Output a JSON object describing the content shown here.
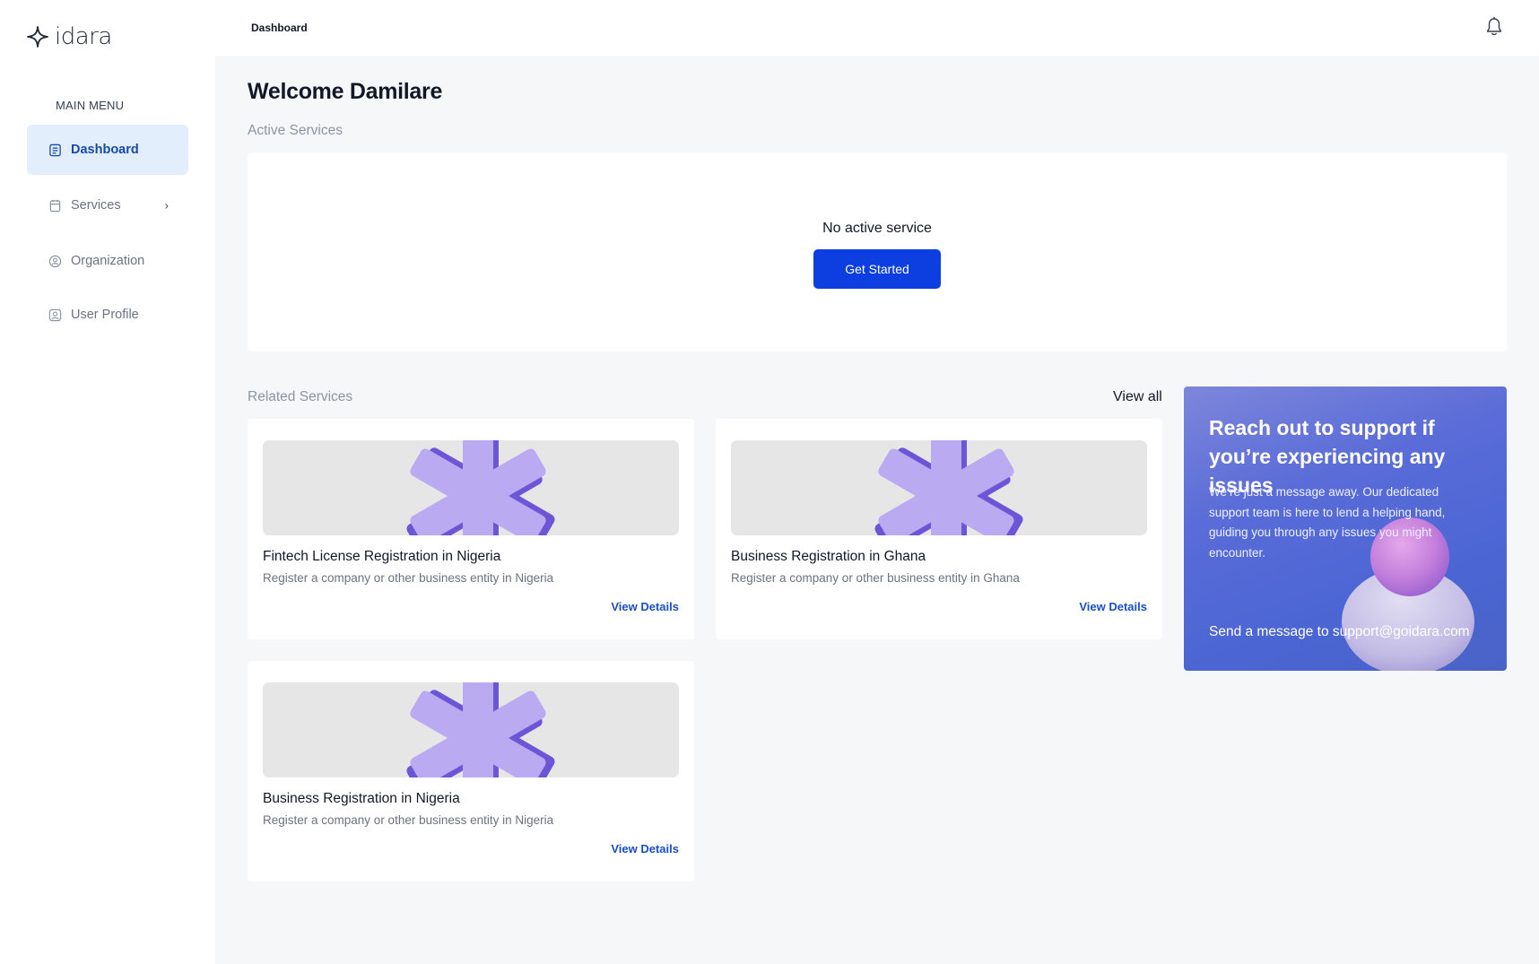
{
  "app": {
    "logo_text": "idara"
  },
  "sidebar": {
    "menu_title": "MAIN MENU",
    "items": [
      {
        "label": "Dashboard",
        "icon": "dashboard-icon",
        "active": true
      },
      {
        "label": "Services",
        "icon": "services-icon",
        "has_submenu": true
      },
      {
        "label": "Organization",
        "icon": "organization-icon"
      },
      {
        "label": "User Profile",
        "icon": "user-profile-icon"
      }
    ]
  },
  "header": {
    "breadcrumb": "Dashboard",
    "notification_icon": "bell-icon"
  },
  "main": {
    "welcome": "Welcome Damilare",
    "active_services": {
      "label": "Active Services",
      "empty_text": "No active service",
      "cta": "Get Started"
    },
    "related_services": {
      "label": "Related Services",
      "view_all": "View all",
      "cards": [
        {
          "title": "Fintech License Registration in Nigeria",
          "description": "Register a company or other business entity in Nigeria",
          "link": "View Details"
        },
        {
          "title": "Business Registration in Ghana",
          "description": "Register a company or other business entity in Ghana",
          "link": "View Details"
        },
        {
          "title": "Business Registration in Nigeria",
          "description": "Register a company or other business entity in Nigeria",
          "link": "View Details"
        }
      ]
    },
    "support": {
      "title": "Reach out to support if you’re experiencing any issues",
      "text": "We’re just a message away. Our dedicated support team is here to lend a helping hand, guiding you through any issues you might encounter.",
      "cta": "Send a message to support@goidara.com"
    }
  },
  "colors": {
    "primary": "#0c3ee0",
    "active_nav_bg": "#e3eefc",
    "link": "#1a4fc4",
    "page_bg": "#f6f7f9"
  }
}
